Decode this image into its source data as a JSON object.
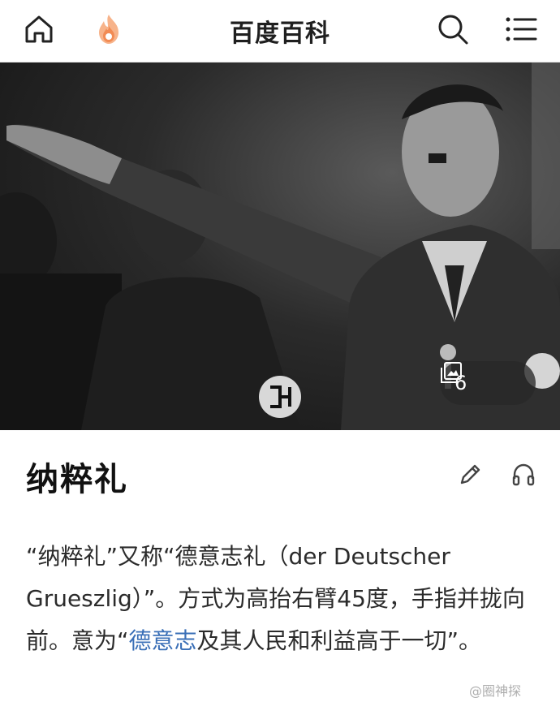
{
  "header": {
    "title": "百度百科",
    "home_icon": "home-icon",
    "hot_icon": "flame-icon",
    "search_icon": "search-icon",
    "menu_icon": "menu-list-icon"
  },
  "hero": {
    "gallery_count": "6",
    "gallery_icon": "image-gallery-icon"
  },
  "article": {
    "title": "纳粹礼",
    "summary_before_link": "“纳粹礼”又称“德意志礼（der Deutscher Grueszlig）”。方式为高抬右臂45度，手指并拢向前。意为“",
    "summary_link": "德意志",
    "summary_after_link": "及其人民和利益高于一切”。",
    "edit_icon": "pencil-icon",
    "audio_icon": "headphones-icon"
  },
  "watermark": {
    "text": "@圈神探"
  },
  "colors": {
    "link": "#3a6fb7",
    "flame": "#f28b54"
  }
}
